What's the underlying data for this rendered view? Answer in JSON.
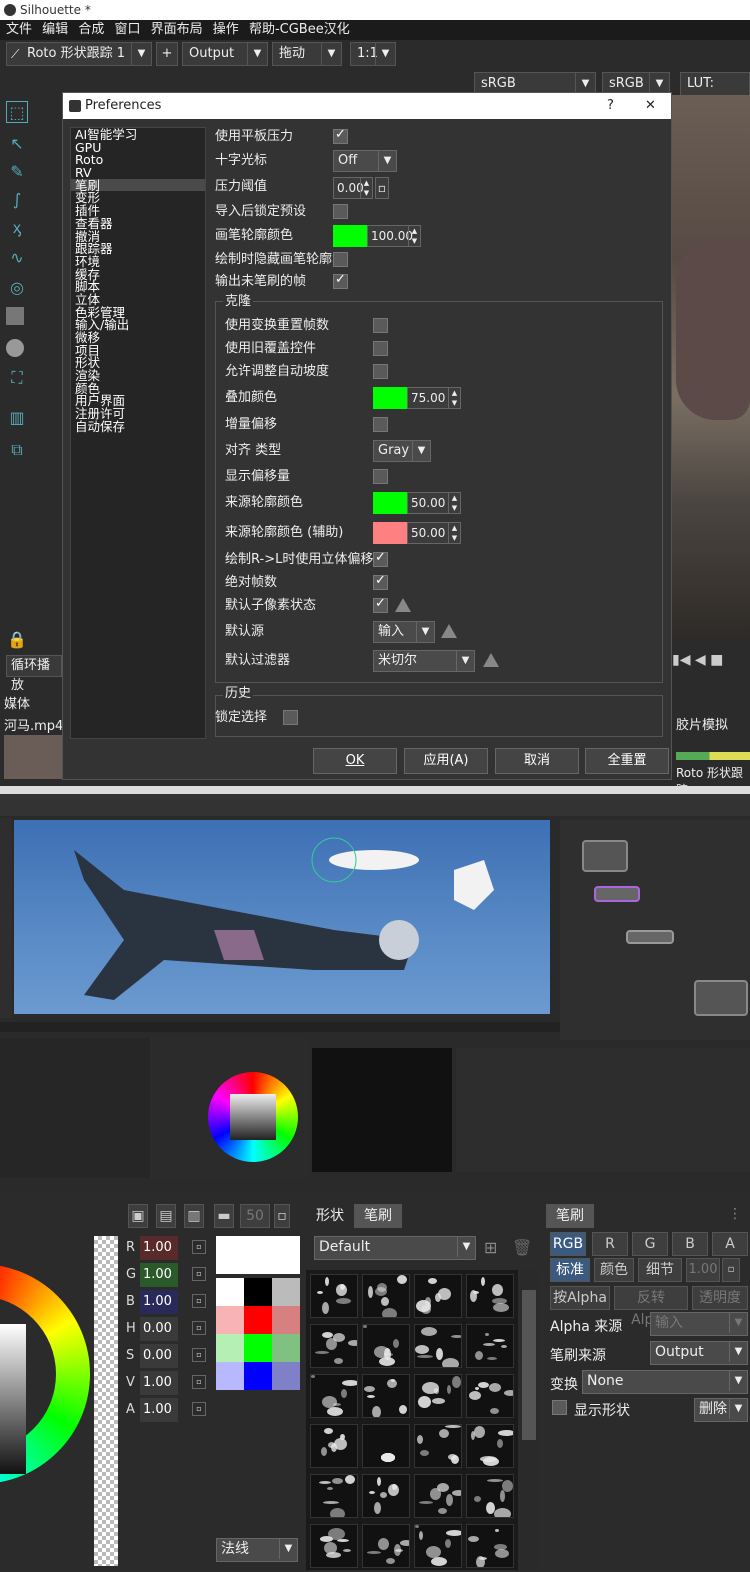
{
  "app": {
    "title": "Silhouette *",
    "menu": [
      "文件",
      "编辑",
      "合成",
      "窗口",
      "界面布局",
      "操作",
      "帮助-CGBee汉化"
    ]
  },
  "toolbar": {
    "roto_node": "Roto 形状跟踪 1",
    "output": "Output",
    "mode": "拖动",
    "zoom": "1:1",
    "cs1": "sRGB",
    "cs2": "sRGB",
    "lut": "LUT: none"
  },
  "sidebar": {
    "loop": "循环播放",
    "media": "媒体",
    "clip": "河马.mp4",
    "film": "胶片模拟",
    "roto_label": "Roto 形状跟踪"
  },
  "dialog": {
    "title": "Preferences",
    "help": "?",
    "close": "✕",
    "categories": [
      "AI智能学习",
      "GPU",
      "Roto",
      "RV",
      "笔刷",
      "变形",
      "插件",
      "查看器",
      "撤消",
      "跟踪器",
      "环境",
      "缓存",
      "脚本",
      "立体",
      "色彩管理",
      "输入/输出",
      "微移",
      "项目",
      "形状",
      "渲染",
      "颜色",
      "用户界面",
      "注册许可",
      "自动保存"
    ],
    "selected": "笔刷",
    "settings": {
      "tablet": "使用平板压力",
      "crosshair": "十字光标",
      "crosshair_val": "Off",
      "pressure": "压力阈值",
      "pressure_val": "0.00",
      "lock_preset": "导入后锁定预设",
      "outline_color": "画笔轮廓颜色",
      "outline_val": "100.00",
      "hide_outline": "绘制时隐藏画笔轮廓",
      "output_frames": "输出未笔刷的帧"
    },
    "clone": {
      "title": "克隆",
      "reset_frames": "使用变换重置帧数",
      "old_overlay": "使用旧覆盖控件",
      "auto_slope": "允许调整自动坡度",
      "overlay_color": "叠加颜色",
      "overlay_val": "75.00",
      "inc_offset": "增量偏移",
      "align": "对齐 类型",
      "align_val": "Gray",
      "show_offset": "显示偏移量",
      "src_color": "来源轮廓颜色",
      "src_val": "50.00",
      "src_color2": "来源轮廓颜色 (辅助)",
      "src_val2": "50.00",
      "stereo": "绘制R->L时使用立体偏移",
      "abs_frames": "绝对帧数",
      "subpixel": "默认子像素状态",
      "def_src": "默认源",
      "def_src_val": "输入",
      "def_filter": "默认过滤器",
      "def_filter_val": "米切尔"
    },
    "history": {
      "title": "历史",
      "lock": "锁定选择"
    },
    "buttons": {
      "ok": "OK",
      "apply": "应用(A)",
      "cancel": "取消",
      "reset": "全重置"
    }
  },
  "colors": {
    "green": "#00ff00",
    "pink": "#ff8080"
  },
  "paint": {
    "tabs": {
      "shape": "形状",
      "brush": "笔刷",
      "brush2": "笔刷"
    },
    "channels": [
      {
        "k": "R",
        "v": "1.00"
      },
      {
        "k": "G",
        "v": "1.00"
      },
      {
        "k": "B",
        "v": "1.00"
      },
      {
        "k": "H",
        "v": "0.00"
      },
      {
        "k": "S",
        "v": "0.00"
      },
      {
        "k": "V",
        "v": "1.00"
      },
      {
        "k": "A",
        "v": "1.00"
      }
    ],
    "size": "50",
    "preset": "Default",
    "normal": "法线",
    "rgba": [
      "RGB",
      "R",
      "G",
      "B",
      "A"
    ],
    "modes": [
      "标准",
      "颜色",
      "细节"
    ],
    "mode_val": "1.00",
    "alpha_btns": [
      "按Alpha",
      "反转 Alpha",
      "透明度"
    ],
    "alpha_src": "Alpha 来源",
    "alpha_src_val": "输入",
    "brush_src": "笔刷来源",
    "brush_src_val": "Output",
    "transform": "变换",
    "transform_val": "None",
    "show_shape": "显示形状",
    "delete": "删除"
  }
}
